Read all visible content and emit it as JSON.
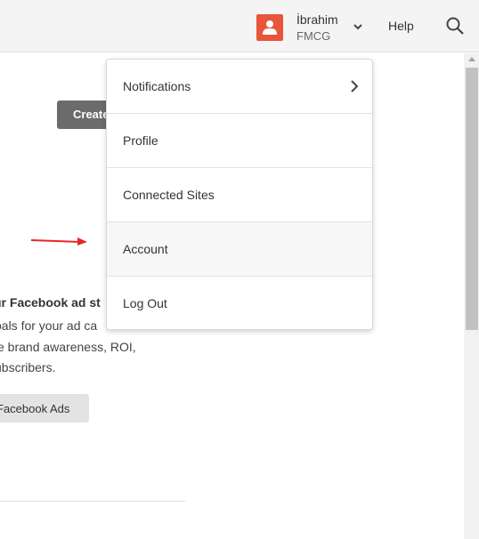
{
  "header": {
    "user_name": "İbrahim",
    "user_org": "FMCG",
    "help_label": "Help"
  },
  "background": {
    "create_label": "Create",
    "heading": "ur Facebook ad st",
    "line1": "oals for your ad ca",
    "line2": "e brand awareness, ROI,",
    "line3": "ubscribers.",
    "fb_button_label": "Facebook Ads"
  },
  "menu": {
    "items": [
      {
        "label": "Notifications"
      },
      {
        "label": "Profile"
      },
      {
        "label": "Connected Sites"
      },
      {
        "label": "Account"
      },
      {
        "label": "Log Out"
      }
    ]
  },
  "colors": {
    "avatar": "#e8553a",
    "annotation_arrow": "#e8262a",
    "create_button": "#6b6b6b"
  }
}
